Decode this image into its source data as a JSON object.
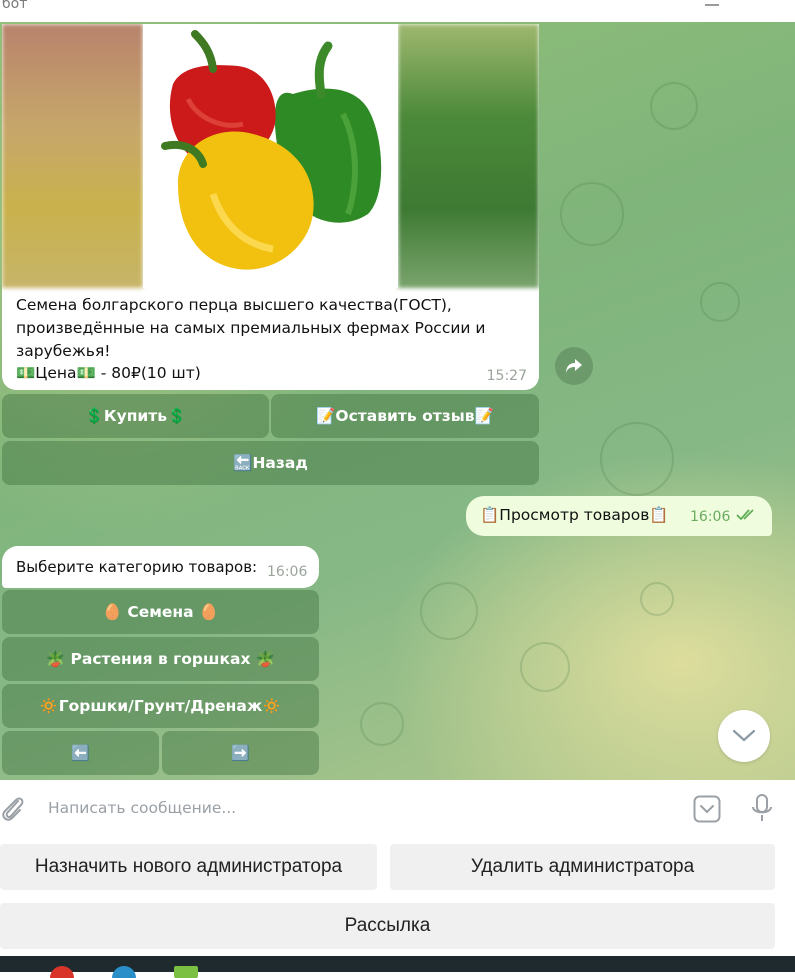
{
  "window": {
    "title": "бот"
  },
  "product_card": {
    "description": "Семена болгарского перца высшего качества(ГОСТ), произведённые на самых премиальных фермах России и зарубежья!",
    "price_line": "💵Цена💵 - 80₽(10 шт)",
    "time": "15:27"
  },
  "product_buttons": {
    "buy": "💲Купить💲",
    "review": "📝Оставить отзыв📝",
    "back": "🔙Назад"
  },
  "outgoing_message": {
    "text": "📋Просмотр товаров📋",
    "time": "16:06"
  },
  "incoming_message": {
    "text": "Выберите категорию товаров:",
    "time": "16:06"
  },
  "category_buttons": {
    "seeds": "🥚 Семена 🥚",
    "plants": "🪴 Растения в горшках 🪴",
    "pots": "🔅Горшки/Грунт/Дренаж🔅",
    "prev": "⬅️",
    "next": "➡️"
  },
  "composer": {
    "placeholder": "Написать сообщение..."
  },
  "reply_keyboard": {
    "assign_admin": "Назначить нового администратора",
    "remove_admin": "Удалить администратора",
    "broadcast": "Рассылка"
  },
  "colors": {
    "chat_bg": "#86b886",
    "outgoing_bubble": "#effdde",
    "inline_button": "#4f8a4f",
    "reply_button": "#f0f0f0"
  }
}
